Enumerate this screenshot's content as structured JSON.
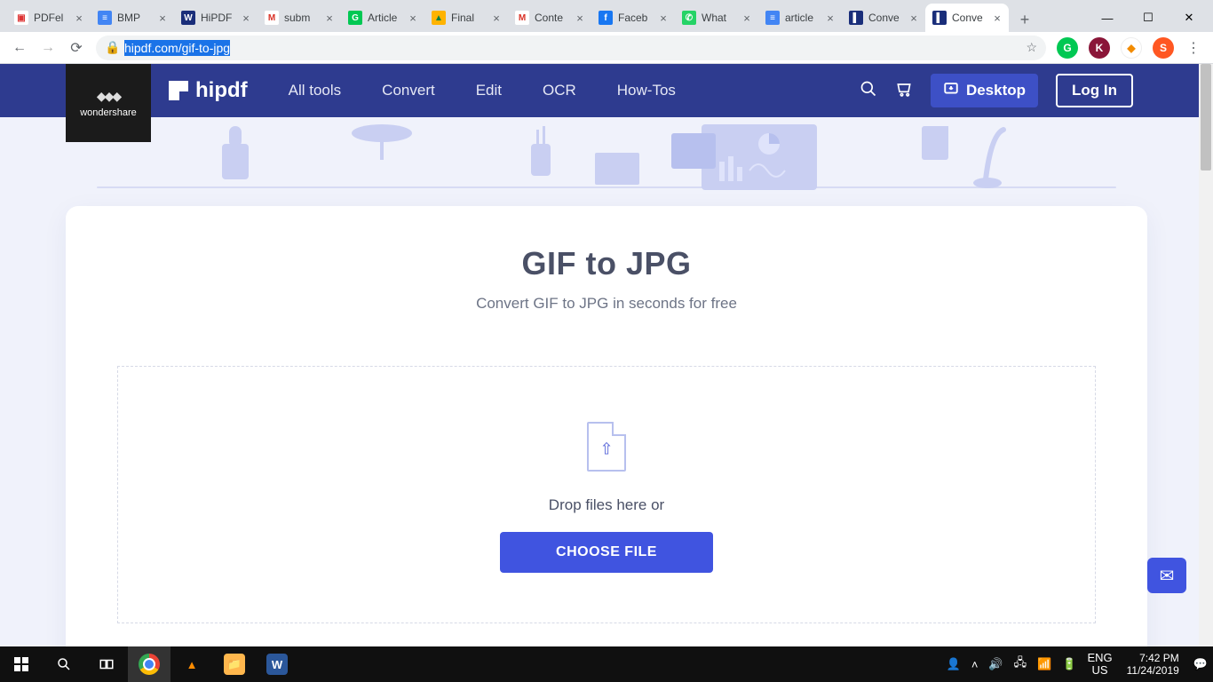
{
  "chrome": {
    "tabs": [
      {
        "title": "PDFel",
        "favbg": "#ffffff",
        "favfg": "#d33",
        "favtxt": "▣"
      },
      {
        "title": "BMP",
        "favbg": "#4285f4",
        "favfg": "#fff",
        "favtxt": "≡"
      },
      {
        "title": "HiPDF",
        "favbg": "#1a2e7a",
        "favfg": "#fff",
        "favtxt": "W"
      },
      {
        "title": "subm",
        "favbg": "#ffffff",
        "favfg": "#d93025",
        "favtxt": "M"
      },
      {
        "title": "Article",
        "favbg": "#00c853",
        "favfg": "#fff",
        "favtxt": "G"
      },
      {
        "title": "Final",
        "favbg": "#ffb300",
        "favfg": "#0b8043",
        "favtxt": "▲"
      },
      {
        "title": "Conte",
        "favbg": "#ffffff",
        "favfg": "#d93025",
        "favtxt": "M"
      },
      {
        "title": "Faceb",
        "favbg": "#1877f2",
        "favfg": "#fff",
        "favtxt": "f"
      },
      {
        "title": "What",
        "favbg": "#25d366",
        "favfg": "#fff",
        "favtxt": "✆"
      },
      {
        "title": "article",
        "favbg": "#4285f4",
        "favfg": "#fff",
        "favtxt": "≡"
      },
      {
        "title": "Conve",
        "favbg": "#1a2e7a",
        "favfg": "#fff",
        "favtxt": "▌"
      },
      {
        "title": "Conve",
        "favbg": "#1a2e7a",
        "favfg": "#fff",
        "favtxt": "▌",
        "active": true
      }
    ],
    "url": "hipdf.com/gif-to-jpg",
    "ext": [
      {
        "bg": "#00c853",
        "txt": "G"
      },
      {
        "bg": "#8a1538",
        "txt": "K"
      },
      {
        "bg": "#ffffff",
        "txt": "◆",
        "fg": "#f28b00"
      },
      {
        "bg": "#ff5722",
        "txt": "S"
      }
    ]
  },
  "header": {
    "wondershare": "wondershare",
    "brand": "hipdf",
    "nav": {
      "all": "All tools",
      "convert": "Convert",
      "edit": "Edit",
      "ocr": "OCR",
      "how": "How-Tos"
    },
    "desktop": "Desktop",
    "login": "Log In"
  },
  "page": {
    "title": "GIF to JPG",
    "subtitle": "Convert GIF to JPG in seconds for free",
    "drop_text": "Drop files here or",
    "choose": "CHOOSE FILE"
  },
  "taskbar": {
    "lang1": "ENG",
    "lang2": "US",
    "time": "7:42 PM",
    "date": "11/24/2019"
  }
}
